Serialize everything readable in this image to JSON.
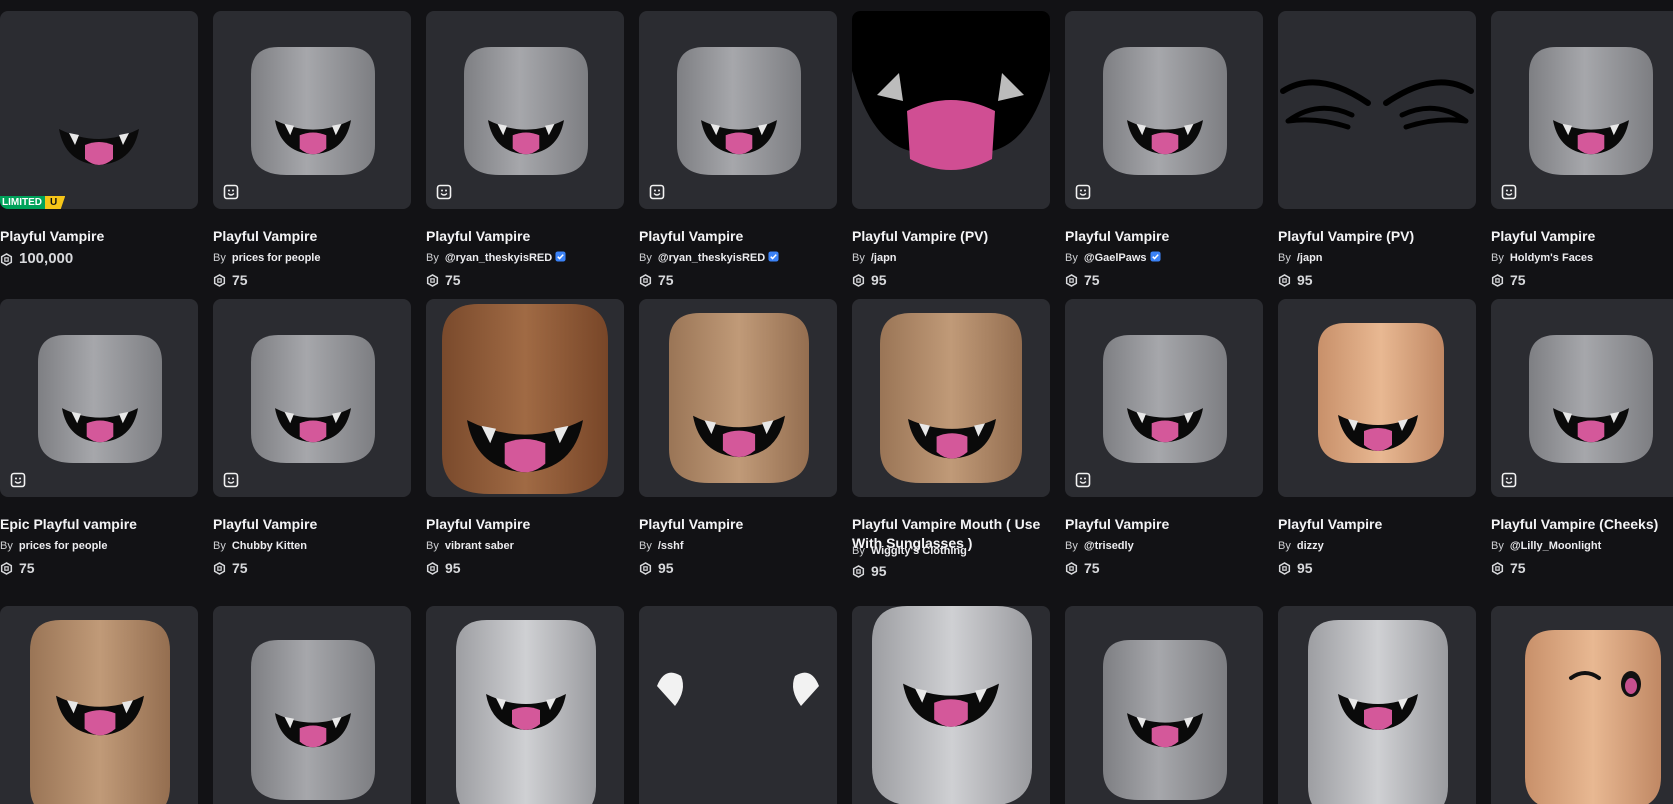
{
  "items": [
    {
      "name": "Playful Vampire",
      "creator": "",
      "verified": false,
      "price": "100,000",
      "limited": true,
      "limited_label": "LIMITED",
      "limited_u": "U",
      "style": "face-only",
      "dynamic": false
    },
    {
      "name": "Playful Vampire",
      "creator": "prices for people",
      "verified": false,
      "price": "75",
      "style": "gray",
      "dynamic": true
    },
    {
      "name": "Playful Vampire",
      "creator": "@ryan_theskyisRED",
      "verified": true,
      "price": "75",
      "style": "gray",
      "dynamic": true
    },
    {
      "name": "Playful Vampire",
      "creator": "@ryan_theskyisRED",
      "verified": true,
      "price": "75",
      "style": "gray",
      "dynamic": true
    },
    {
      "name": "Playful Vampire (PV)",
      "creator": "/japn",
      "verified": false,
      "price": "95",
      "style": "mouth-closeup",
      "dynamic": false
    },
    {
      "name": "Playful Vampire",
      "creator": "@GaelPaws",
      "verified": true,
      "price": "75",
      "style": "gray",
      "dynamic": true
    },
    {
      "name": "Playful Vampire (PV)",
      "creator": "/japn",
      "verified": false,
      "price": "95",
      "style": "eyes-closeup",
      "dynamic": false
    },
    {
      "name": "Playful Vampire",
      "creator": "Holdym's Faces",
      "verified": false,
      "price": "75",
      "style": "gray",
      "dynamic": true
    },
    {
      "name": "Epic Playful vampire",
      "creator": "prices for people",
      "verified": false,
      "price": "75",
      "style": "gray",
      "dynamic": true
    },
    {
      "name": "Playful Vampire",
      "creator": "Chubby Kitten",
      "verified": false,
      "price": "75",
      "style": "gray",
      "dynamic": true
    },
    {
      "name": "Playful Vampire",
      "creator": "vibrant saber",
      "verified": false,
      "price": "95",
      "style": "brown",
      "dynamic": false
    },
    {
      "name": "Playful Vampire",
      "creator": "/sshf",
      "verified": false,
      "price": "95",
      "style": "tan",
      "dynamic": false
    },
    {
      "name": "Playful Vampire Mouth ( Use With Sunglasses )",
      "creator": "Wiggity's Clothing",
      "verified": false,
      "price": "95",
      "style": "tan-mouth",
      "dynamic": false
    },
    {
      "name": "Playful Vampire",
      "creator": "@trisedly",
      "verified": false,
      "price": "75",
      "style": "gray",
      "dynamic": true
    },
    {
      "name": "Playful Vampire",
      "creator": "dizzy",
      "verified": false,
      "price": "95",
      "style": "peach",
      "dynamic": false
    },
    {
      "name": "Playful Vampire (Cheeks)",
      "creator": "@Lilly_Moonlight",
      "verified": false,
      "price": "75",
      "style": "gray",
      "dynamic": true
    },
    {
      "style": "tan-partial"
    },
    {
      "style": "gray-partial"
    },
    {
      "style": "light-partial"
    },
    {
      "style": "hands-partial"
    },
    {
      "style": "big-gray-partial"
    },
    {
      "style": "gray-partial"
    },
    {
      "style": "light-partial"
    },
    {
      "style": "wink-partial"
    }
  ],
  "labels": {
    "by": "By"
  },
  "colors": {
    "background": "#121215",
    "card": "#2b2c31",
    "limited": "#00a25a",
    "limited_u": "#f5c518",
    "verified": "#3b82f6"
  }
}
